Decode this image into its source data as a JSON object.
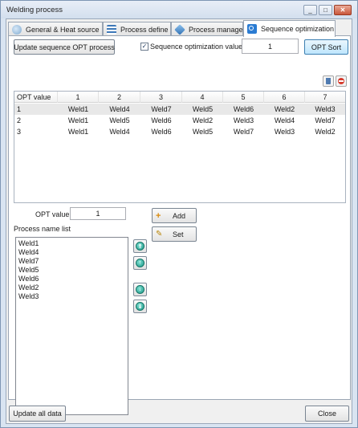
{
  "window": {
    "title": "Welding process",
    "minimize": "_",
    "maximize": "□",
    "close": "✕"
  },
  "tabs": [
    {
      "label": "General & Heat source",
      "icon": "heat-source-icon",
      "active": false
    },
    {
      "label": "Process define",
      "icon": "process-define-icon",
      "active": false
    },
    {
      "label": "Process manager",
      "icon": "layers-icon",
      "active": false
    },
    {
      "label": "Sequence optimization",
      "icon": "search-icon",
      "active": true
    }
  ],
  "toolbar": {
    "update_sequence_label": "Update sequence OPT process",
    "seq_opt_checked": true,
    "check_mark": "✓",
    "seq_opt_label": "Sequence optimization value",
    "seq_opt_value": "1",
    "opt_sort_label": "OPT Sort"
  },
  "grid_icons": {
    "delete": "trash-icon",
    "remove": "minus-icon"
  },
  "table": {
    "headers": [
      "OPT value",
      "1",
      "2",
      "3",
      "4",
      "5",
      "6",
      "7"
    ],
    "rows": [
      [
        "1",
        "Weld1",
        "Weld4",
        "Weld7",
        "Weld5",
        "Weld6",
        "Weld2",
        "Weld3"
      ],
      [
        "2",
        "Weld1",
        "Weld5",
        "Weld6",
        "Weld2",
        "Weld3",
        "Weld4",
        "Weld7"
      ],
      [
        "3",
        "Weld1",
        "Weld4",
        "Weld6",
        "Weld5",
        "Weld7",
        "Weld3",
        "Weld2"
      ]
    ],
    "selected_row": 0
  },
  "opt_value": {
    "label": "OPT value",
    "value": "1"
  },
  "process_list": {
    "label": "Process name list",
    "items": [
      "Weld1",
      "Weld4",
      "Weld7",
      "Weld5",
      "Weld6",
      "Weld2",
      "Weld3"
    ]
  },
  "actions": {
    "add_label": "Add",
    "add_icon": "plus-icon",
    "add_glyph": "+",
    "set_label": "Set",
    "set_icon": "edit-icon",
    "set_glyph": "✎"
  },
  "reorder": {
    "top": "⇑",
    "up": "↑",
    "down": "↓",
    "bottom": "⇓"
  },
  "footer": {
    "update_all_label": "Update all data",
    "close_label": "Close"
  },
  "colors": {
    "accent": "#3c7fb1",
    "title_bg": "#d9e4f1",
    "selected_row": "#e8e8e8",
    "reorder_icon": "#1e9a8a"
  }
}
